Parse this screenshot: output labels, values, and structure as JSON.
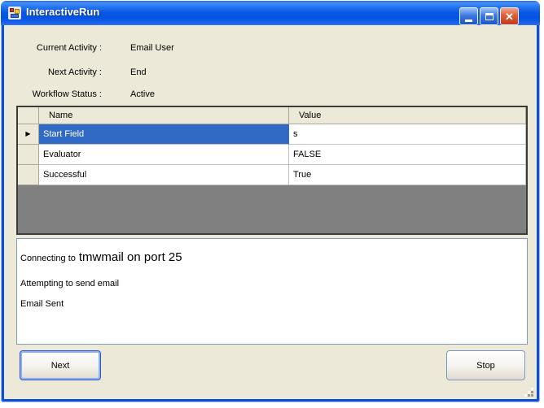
{
  "window": {
    "title": "InteractiveRun",
    "icon": "winforms-app-icon"
  },
  "info": {
    "rows": [
      {
        "label": "Current Activity :",
        "value": "Email User"
      },
      {
        "label": "Next Activity :",
        "value": "End"
      },
      {
        "label": "Workflow Status :",
        "value": "Active"
      }
    ]
  },
  "grid": {
    "columns": [
      "Name",
      "Value"
    ],
    "rows": [
      {
        "name": "Start Field",
        "value": "s",
        "selected": true
      },
      {
        "name": "Evaluator",
        "value": "FALSE",
        "selected": false
      },
      {
        "name": "Successful",
        "value": "True",
        "selected": false
      }
    ]
  },
  "log": {
    "line1_prefix": "Connecting to",
    "line1_detail": "tmwmail on port 25",
    "line2": "Attempting to send email",
    "line3": "Email Sent"
  },
  "buttons": {
    "next": "Next",
    "stop": "Stop"
  },
  "colors": {
    "titlebar_blue": "#0353E2",
    "selection_blue": "#316AC5",
    "client_bg": "#ECE9D8",
    "grid_backplate": "#808080",
    "close_red": "#D6492A",
    "textbox_border": "#7F9DB9"
  }
}
